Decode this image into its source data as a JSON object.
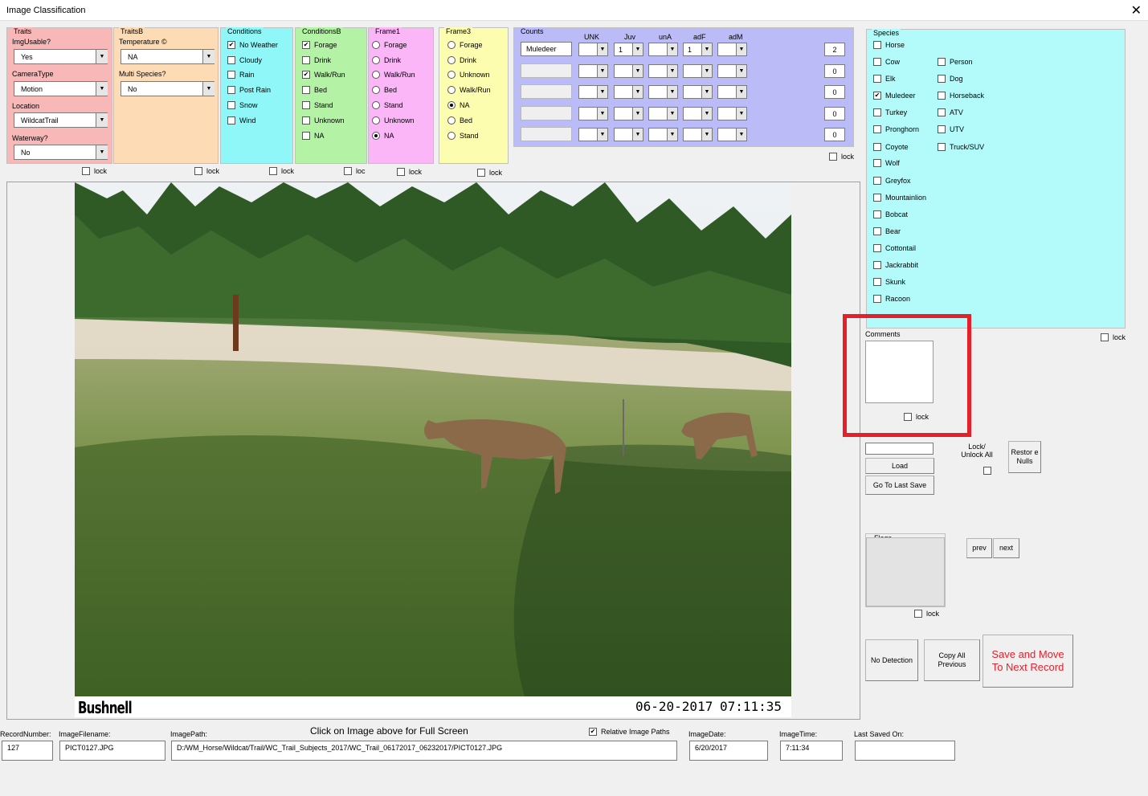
{
  "window": {
    "title": "Image Classification",
    "close": "✕"
  },
  "traits": {
    "legend": "Traits",
    "img_usable_label": "ImgUsable?",
    "img_usable": "Yes",
    "camera_type_label": "CameraType",
    "camera_type": "Motion",
    "location_label": "Location",
    "location": "WildcatTrail",
    "waterway_label": "Waterway?",
    "waterway": "No"
  },
  "traitsb": {
    "legend": "TraitsB",
    "temperature_label": "Temperature ©",
    "temperature": "NA",
    "multi_species_label": "Multi Species?",
    "multi_species": "No"
  },
  "conditions": {
    "legend": "Conditions",
    "items": [
      {
        "label": "No Weather",
        "mark": "✔"
      },
      {
        "label": "Cloudy",
        "mark": ""
      },
      {
        "label": "Rain",
        "mark": ""
      },
      {
        "label": "Post Rain",
        "mark": ""
      },
      {
        "label": "Snow",
        "mark": ""
      },
      {
        "label": "Wind",
        "mark": ""
      }
    ]
  },
  "conditionsb": {
    "legend": "ConditionsB",
    "items": [
      {
        "label": "Forage",
        "mark": "✔"
      },
      {
        "label": "Drink",
        "mark": ""
      },
      {
        "label": "Walk/Run",
        "mark": "✔"
      },
      {
        "label": "Bed",
        "mark": ""
      },
      {
        "label": "Stand",
        "mark": ""
      },
      {
        "label": "Unknown",
        "mark": ""
      },
      {
        "label": "NA",
        "mark": ""
      }
    ]
  },
  "frame1": {
    "legend": "Frame1",
    "items": [
      "Forage",
      "Drink",
      "Walk/Run",
      "Bed",
      "Stand",
      "Unknown",
      "NA"
    ],
    "selected": "NA"
  },
  "frame3": {
    "legend": "Frame3",
    "items": [
      "Forage",
      "Drink",
      "Unknown",
      "Walk/Run",
      "NA",
      "Bed",
      "Stand"
    ],
    "selected": "NA"
  },
  "counts": {
    "legend": "Counts",
    "columns": [
      "UNK",
      "Juv",
      "unA",
      "adF",
      "adM"
    ],
    "rows": [
      {
        "species": "Muledeer",
        "cells": [
          "",
          "1",
          "",
          "1",
          ""
        ],
        "total": "2"
      },
      {
        "species": "",
        "cells": [
          "",
          "",
          "",
          "",
          ""
        ],
        "total": "0"
      },
      {
        "species": "",
        "cells": [
          "",
          "",
          "",
          "",
          ""
        ],
        "total": "0"
      },
      {
        "species": "",
        "cells": [
          "",
          "",
          "",
          "",
          ""
        ],
        "total": "0"
      },
      {
        "species": "",
        "cells": [
          "",
          "",
          "",
          "",
          ""
        ],
        "total": "0"
      }
    ]
  },
  "species": {
    "legend": "Species",
    "col1": [
      {
        "label": "Horse",
        "mark": ""
      },
      {
        "label": "Cow",
        "mark": ""
      },
      {
        "label": "Elk",
        "mark": ""
      },
      {
        "label": "Muledeer",
        "mark": "✔"
      },
      {
        "label": "Turkey",
        "mark": ""
      },
      {
        "label": "Pronghorn",
        "mark": ""
      },
      {
        "label": "Coyote",
        "mark": ""
      },
      {
        "label": "Wolf",
        "mark": ""
      },
      {
        "label": "Greyfox",
        "mark": ""
      },
      {
        "label": "Mountainlion",
        "mark": ""
      },
      {
        "label": "Bobcat",
        "mark": ""
      },
      {
        "label": "Bear",
        "mark": ""
      },
      {
        "label": "Cottontail",
        "mark": ""
      },
      {
        "label": "Jackrabbit",
        "mark": ""
      },
      {
        "label": "Skunk",
        "mark": ""
      },
      {
        "label": "Racoon",
        "mark": ""
      }
    ],
    "col2": [
      {
        "label": "Person",
        "mark": ""
      },
      {
        "label": "Dog",
        "mark": ""
      },
      {
        "label": "Horseback",
        "mark": ""
      },
      {
        "label": "ATV",
        "mark": ""
      },
      {
        "label": "UTV",
        "mark": ""
      },
      {
        "label": "Truck/SUV",
        "mark": ""
      }
    ]
  },
  "locks": {
    "lock": "lock",
    "loc": "loc"
  },
  "comments": {
    "label": "Comments"
  },
  "controls": {
    "lock_unlock_all": "Lock/ Unlock All",
    "restore_nulls": "Restor e Nulls",
    "load": "Load",
    "go_to_last_save": "Go To Last Save",
    "flags": "Flags",
    "prev": "prev",
    "next": "next",
    "no_detection": "No Detection",
    "copy_all_previous": "Copy All Previous",
    "save_and_move": "Save and Move To Next Record"
  },
  "image": {
    "brand": "Bushnell",
    "date_stamp": "06-20-2017",
    "time_stamp": "07:11:35",
    "hint": "Click on Image above for Full Screen"
  },
  "footer": {
    "record_number_label": "RecordNumber:",
    "record_number": "127",
    "image_filename_label": "ImageFilename:",
    "image_filename": "PICT0127.JPG",
    "image_path_label": "ImagePath:",
    "image_path": "D:/WM_Horse/Wildcat/Trail/WC_Trail_Subjects_2017/WC_Trail_06172017_06232017/PICT0127.JPG",
    "relative_paths_label": "Relative Image Paths",
    "relative_paths_mark": "✔",
    "image_date_label": "ImageDate:",
    "image_date": "6/20/2017",
    "image_time_label": "ImageTime:",
    "image_time": "7:11:34",
    "last_saved_label": "Last Saved On:",
    "last_saved": ""
  },
  "colors": {
    "traits": "#f9b8b8",
    "traitsb": "#fddcb5",
    "conditions": "#8ff7f7",
    "conditionsb": "#b4f3a5",
    "frame1": "#fbb6f8",
    "frame3": "#fdfdb0",
    "counts": "#bbbbf7",
    "species": "#b3fbfb",
    "highlight": "#e5202a",
    "save_text": "#e5202a"
  }
}
